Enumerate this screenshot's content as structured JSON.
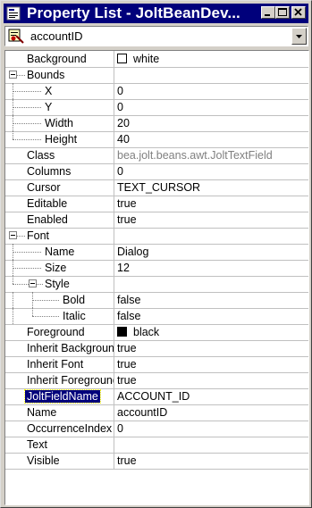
{
  "window": {
    "title": "Property List - JoltBeanDev..."
  },
  "selector": {
    "value": "accountID"
  },
  "properties": [
    {
      "name": "Background",
      "value": "white",
      "swatch": "#ffffff",
      "depth": 0
    },
    {
      "name": "Bounds",
      "value": "",
      "expander": "minus",
      "depth": 0
    },
    {
      "name": "X",
      "value": "0",
      "depth": 1
    },
    {
      "name": "Y",
      "value": "0",
      "depth": 1
    },
    {
      "name": "Width",
      "value": "20",
      "depth": 1
    },
    {
      "name": "Height",
      "value": "40",
      "depth": 1,
      "last": true
    },
    {
      "name": "Class",
      "value": "bea.jolt.beans.awt.JoltTextField",
      "readonly": true,
      "depth": 0
    },
    {
      "name": "Columns",
      "value": "0",
      "depth": 0
    },
    {
      "name": "Cursor",
      "value": "TEXT_CURSOR",
      "depth": 0
    },
    {
      "name": "Editable",
      "value": "true",
      "depth": 0
    },
    {
      "name": "Enabled",
      "value": "true",
      "depth": 0
    },
    {
      "name": "Font",
      "value": "",
      "expander": "minus",
      "depth": 0
    },
    {
      "name": "Name",
      "value": "Dialog",
      "depth": 1
    },
    {
      "name": "Size",
      "value": "12",
      "depth": 1
    },
    {
      "name": "Style",
      "value": "",
      "expander": "minus",
      "depth": 1,
      "last": true
    },
    {
      "name": "Bold",
      "value": "false",
      "depth": 2
    },
    {
      "name": "Italic",
      "value": "false",
      "depth": 2,
      "last": true
    },
    {
      "name": "Foreground",
      "value": "black",
      "swatch": "#000000",
      "depth": 0
    },
    {
      "name": "Inherit Background",
      "value": "true",
      "depth": 0
    },
    {
      "name": "Inherit Font",
      "value": "true",
      "depth": 0
    },
    {
      "name": "Inherit Foreground",
      "value": "true",
      "depth": 0
    },
    {
      "name": "JoltFieldName",
      "value": "ACCOUNT_ID",
      "selected": true,
      "depth": 0
    },
    {
      "name": "Name",
      "value": "accountID",
      "depth": 0
    },
    {
      "name": "OccurrenceIndex",
      "value": "0",
      "depth": 0
    },
    {
      "name": "Text",
      "value": "",
      "depth": 0
    },
    {
      "name": "Visible",
      "value": "true",
      "depth": 0
    }
  ],
  "colors": {
    "titlebar": "#00007b",
    "face": "#d4d0c8",
    "gridline": "#c0c0c0"
  }
}
